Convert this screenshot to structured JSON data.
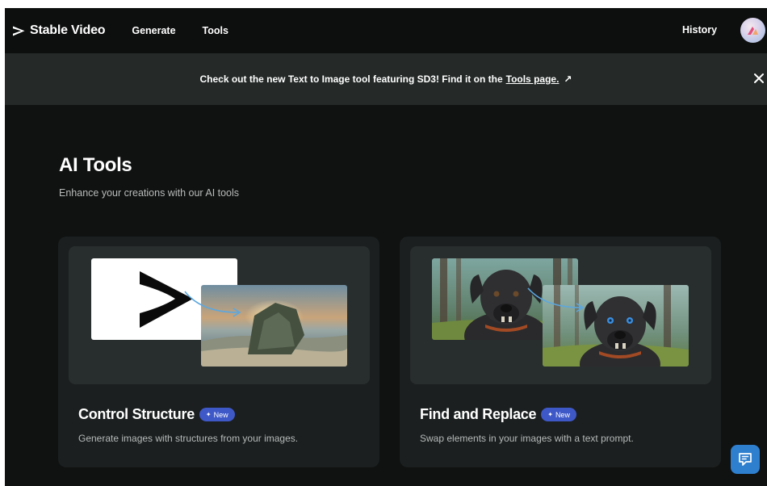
{
  "header": {
    "brand": "Stable Video",
    "nav": [
      "Generate",
      "Tools"
    ],
    "history": "History"
  },
  "banner": {
    "text": "Check out the new Text to Image tool featuring SD3! Find it on the",
    "link": "Tools page.",
    "arrow": "↗",
    "close": "✕"
  },
  "main": {
    "title": "AI Tools",
    "subtitle": "Enhance your creations with our AI tools"
  },
  "cards": [
    {
      "title": "Control Structure",
      "badge": "New",
      "description": "Generate images with structures from your images."
    },
    {
      "title": "Find and Replace",
      "badge": "New",
      "description": "Swap elements in your images with a text prompt."
    }
  ],
  "colors": {
    "background": "#101111",
    "banner": "#252a29",
    "card": "#1b1f1f",
    "badge": "#3e58c8",
    "chat_button": "#2f7fcf"
  },
  "icons": {
    "brand": "play-logo-icon",
    "close": "close-icon",
    "badge": "sparkle-icon",
    "chat": "chat-icon"
  }
}
